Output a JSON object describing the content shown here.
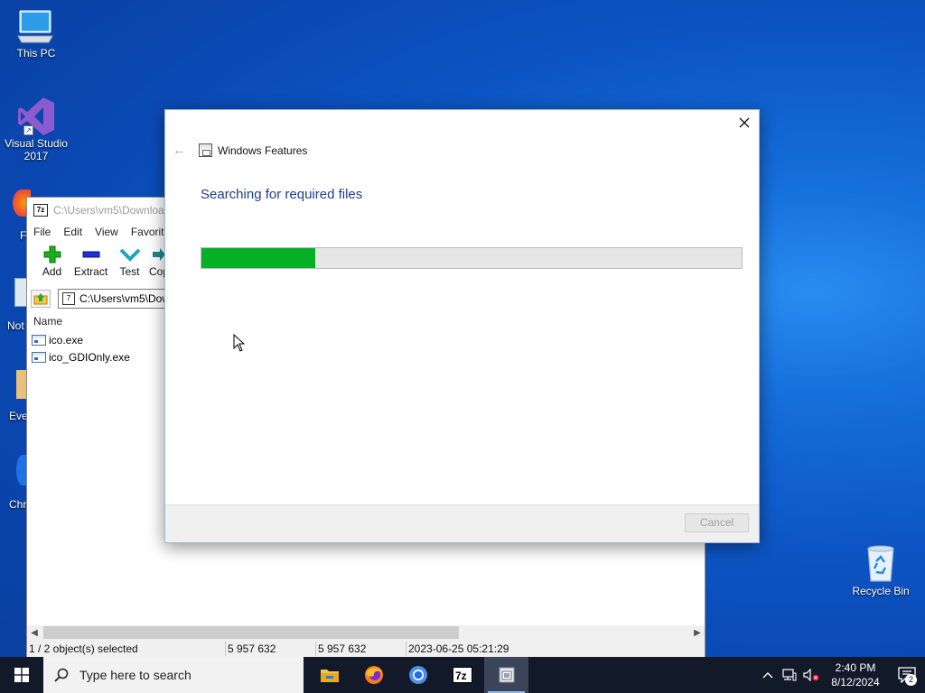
{
  "desktop": {
    "icons": [
      {
        "label": "This PC"
      },
      {
        "label": "Visual Studio\n2017"
      },
      {
        "label": "Recycle Bin"
      }
    ],
    "partial_labels": [
      "F",
      "Not",
      "Eve",
      "Chr"
    ]
  },
  "zip_window": {
    "title": "C:\\Users\\vm5\\Downloa",
    "menu": [
      "File",
      "Edit",
      "View",
      "Favorite"
    ],
    "toolbar": [
      "Add",
      "Extract",
      "Test",
      "Cop"
    ],
    "address": "C:\\Users\\vm5\\Dow",
    "column_name": "Name",
    "files": [
      "ico.exe",
      "ico_GDIOnly.exe"
    ],
    "status": {
      "selection": "1 / 2 object(s) selected",
      "size": "5 957 632",
      "packed": "5 957 632",
      "modified": "2023-06-25 05:21:29"
    }
  },
  "dialog": {
    "title": "Windows Features",
    "heading": "Searching for required files",
    "progress_fraction": 0.21,
    "cancel_label": "Cancel"
  },
  "taskbar": {
    "search_placeholder": "Type here to search",
    "apps": [
      "file-explorer-icon",
      "firefox-icon",
      "chrome-icon",
      "7zip-icon",
      "windows-features-icon"
    ],
    "time": "2:40 PM",
    "date": "8/12/2024",
    "notification_count": "2"
  },
  "colors": {
    "progress": "#06b025",
    "heading": "#1e3c8c",
    "taskbar": "#121a2a"
  }
}
